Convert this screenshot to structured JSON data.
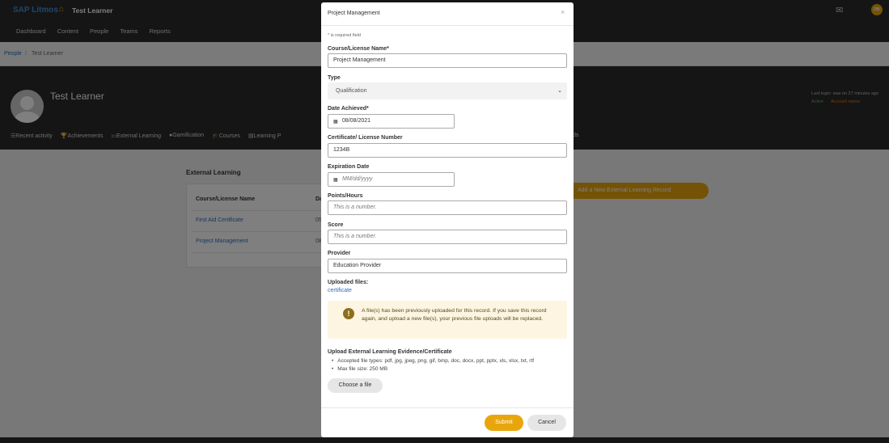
{
  "app": {
    "brand": "SAP Litmos",
    "user": "Test Learner",
    "nav": [
      "Dashboard",
      "Content",
      "People",
      "Teams",
      "Reports"
    ],
    "avatar_initials": "DB"
  },
  "breadcrumb": {
    "root": "People",
    "separator": "/",
    "current": "Test Learner"
  },
  "profile": {
    "name": "Test Learner",
    "last_login": "Last login: was on 27 minutes ago",
    "status_active": "Active",
    "status_owner": "Account owner",
    "tabs": [
      "Recent activity",
      "Achievements",
      "External Learning",
      "Gamification",
      "Courses",
      "Learning P"
    ],
    "tab_tail": "ds"
  },
  "external_learning": {
    "title": "External Learning",
    "col_name": "Course/License Name",
    "col_date": "Da",
    "rows": [
      {
        "name": "First Aid Certificate",
        "date": "05"
      },
      {
        "name": "Project Management",
        "date": "08"
      }
    ],
    "add_button": "Add a New External Learning Record"
  },
  "modal": {
    "title": "Project Management",
    "close": "×",
    "required_note": "* is required field",
    "fields": {
      "name_label": "Course/License Name*",
      "name_value": "Project Management",
      "type_label": "Type",
      "type_value": "Qualification",
      "date_label": "Date Achieved*",
      "date_value": "08/08/2021",
      "cert_label": "Certificate/ License Number",
      "cert_value": "1234B",
      "expiry_label": "Expiration Date",
      "expiry_placeholder": "MM/dd/yyyy",
      "points_label": "Points/Hours",
      "points_placeholder": "This is a number.",
      "score_label": "Score",
      "score_placeholder": "This is a number.",
      "provider_label": "Provider",
      "provider_value": "Education Provider"
    },
    "uploaded_label": "Uploaded files:",
    "uploaded_file": "certificate",
    "alert_text": "A file(s) has been previously uploaded for this record. If you save this record again, and upload a new file(s), your previous file uploads will be replaced.",
    "upload_label": "Upload External Learning Evidence/Certificate",
    "accepted": "Accepted file types: pdf, jpg, jpeg, png, gif, bmp, doc, docx, ppt, pptx, xls, xlsx, txt, rtf",
    "max_size": "Max file size: 250 MB",
    "choose_button": "Choose a file",
    "submit_button": "Submit",
    "cancel_button": "Cancel"
  },
  "colors": {
    "accent": "#e8a60d",
    "link": "#2a6ebb",
    "dark": "#2b2b2b",
    "alert_bg": "#fdf5e1"
  }
}
